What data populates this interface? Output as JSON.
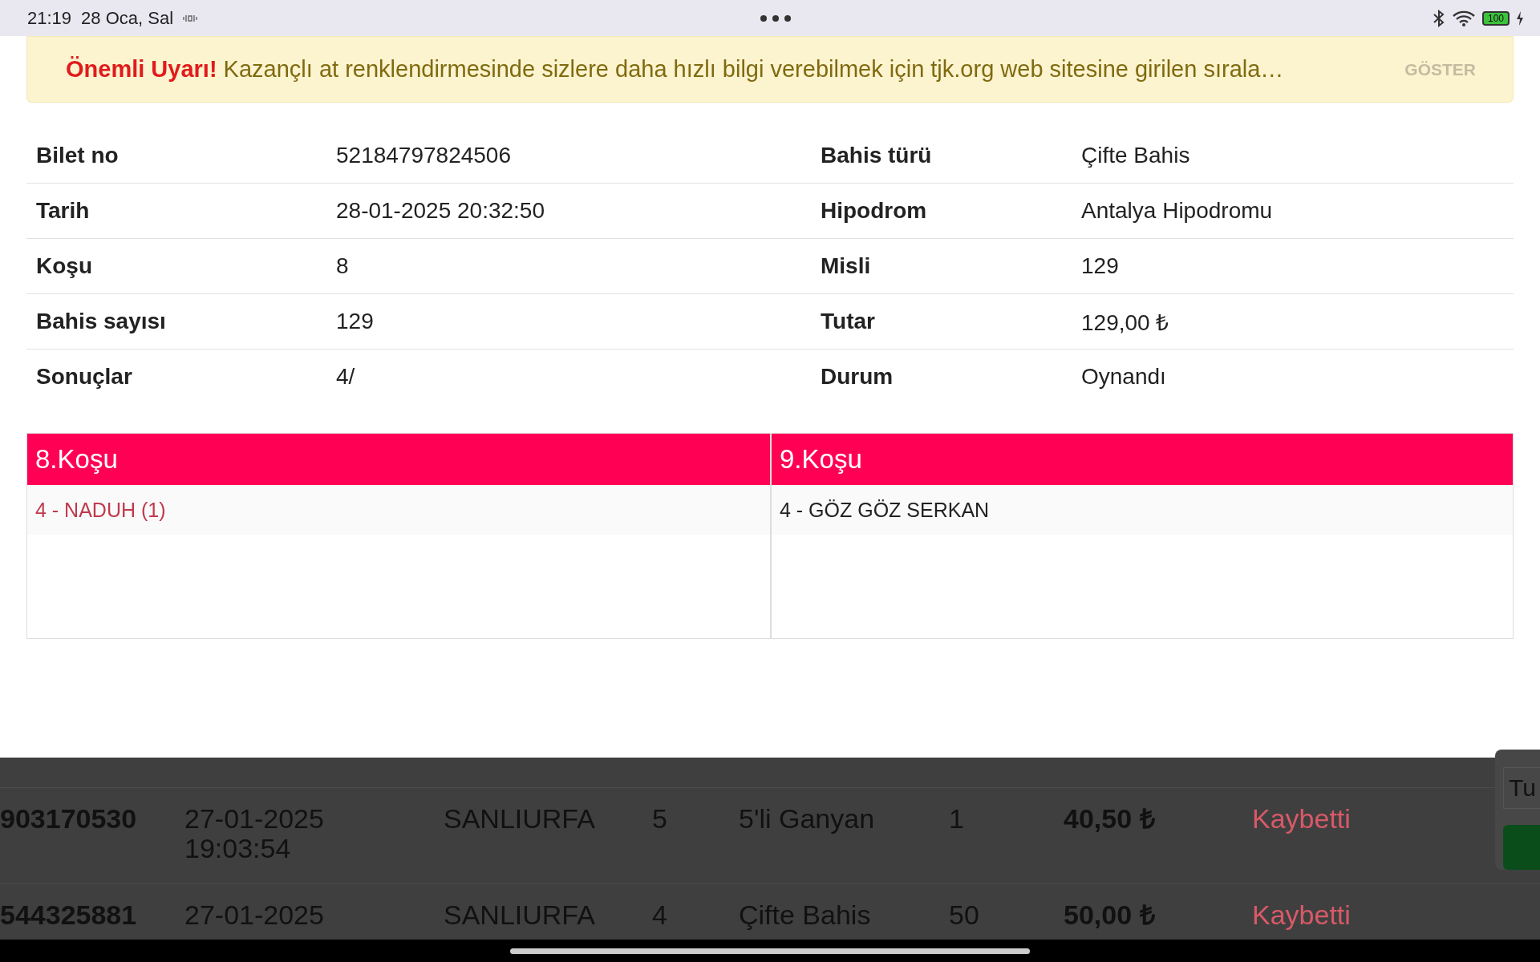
{
  "status_bar": {
    "time": "21:19",
    "date": "28 Oca, Sal",
    "battery": "100"
  },
  "alert": {
    "title": "Önemli Uyarı!",
    "message": "Kazançlı at renklendirmesinde sizlere daha hızlı bilgi verebilmek için tjk.org web sitesine girilen sırala…",
    "action": "GÖSTER"
  },
  "details": [
    {
      "label": "Bilet no",
      "value": "52184797824506",
      "label2": "Bahis türü",
      "value2": "Çifte Bahis"
    },
    {
      "label": "Tarih",
      "value": "28-01-2025 20:32:50",
      "label2": "Hipodrom",
      "value2": "Antalya Hipodromu"
    },
    {
      "label": "Koşu",
      "value": "8",
      "label2": "Misli",
      "value2": "129"
    },
    {
      "label": "Bahis sayısı",
      "value": "129",
      "label2": "Tutar",
      "value2": "129,00 ₺"
    },
    {
      "label": "Sonuçlar",
      "value": "4/",
      "label2": "Durum",
      "value2": "Oynandı"
    }
  ],
  "races": [
    {
      "title": "8.Koşu",
      "entries": [
        {
          "text": "4 - NADUH (1)",
          "highlighted": true
        }
      ]
    },
    {
      "title": "9.Koşu",
      "entries": [
        {
          "text": "4 - GÖZ GÖZ SERKAN",
          "highlighted": false
        }
      ]
    }
  ],
  "background_rows": [
    {
      "ticket": "903170530",
      "date": "27-01-2025",
      "time": "19:03:54",
      "track": "SANLIURFA",
      "race": "5",
      "bet": "5'li Ganyan",
      "multiplier": "1",
      "amount": "40,50 ₺",
      "status": "Kaybetti",
      "kind": "lost"
    },
    {
      "ticket": "544325881",
      "date": "27-01-2025",
      "track": "SANLIURFA",
      "race": "4",
      "bet": "Çifte Bahis",
      "multiplier": "50",
      "amount": "50,00 ₺",
      "status": "Kaybetti",
      "kind": "lost"
    }
  ],
  "side_dialog": {
    "field_value": "Tu"
  }
}
